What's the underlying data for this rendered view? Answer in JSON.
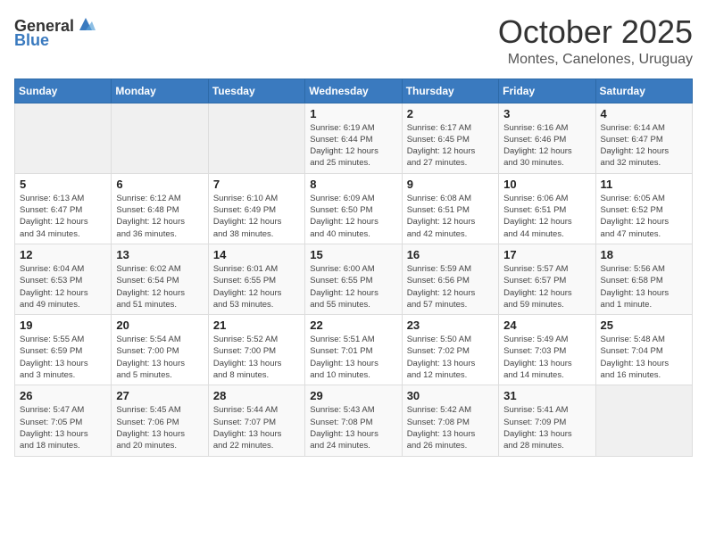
{
  "logo": {
    "general": "General",
    "blue": "Blue"
  },
  "title": {
    "month": "October 2025",
    "location": "Montes, Canelones, Uruguay"
  },
  "weekdays": [
    "Sunday",
    "Monday",
    "Tuesday",
    "Wednesday",
    "Thursday",
    "Friday",
    "Saturday"
  ],
  "weeks": [
    [
      {
        "day": "",
        "info": ""
      },
      {
        "day": "",
        "info": ""
      },
      {
        "day": "",
        "info": ""
      },
      {
        "day": "1",
        "info": "Sunrise: 6:19 AM\nSunset: 6:44 PM\nDaylight: 12 hours\nand 25 minutes."
      },
      {
        "day": "2",
        "info": "Sunrise: 6:17 AM\nSunset: 6:45 PM\nDaylight: 12 hours\nand 27 minutes."
      },
      {
        "day": "3",
        "info": "Sunrise: 6:16 AM\nSunset: 6:46 PM\nDaylight: 12 hours\nand 30 minutes."
      },
      {
        "day": "4",
        "info": "Sunrise: 6:14 AM\nSunset: 6:47 PM\nDaylight: 12 hours\nand 32 minutes."
      }
    ],
    [
      {
        "day": "5",
        "info": "Sunrise: 6:13 AM\nSunset: 6:47 PM\nDaylight: 12 hours\nand 34 minutes."
      },
      {
        "day": "6",
        "info": "Sunrise: 6:12 AM\nSunset: 6:48 PM\nDaylight: 12 hours\nand 36 minutes."
      },
      {
        "day": "7",
        "info": "Sunrise: 6:10 AM\nSunset: 6:49 PM\nDaylight: 12 hours\nand 38 minutes."
      },
      {
        "day": "8",
        "info": "Sunrise: 6:09 AM\nSunset: 6:50 PM\nDaylight: 12 hours\nand 40 minutes."
      },
      {
        "day": "9",
        "info": "Sunrise: 6:08 AM\nSunset: 6:51 PM\nDaylight: 12 hours\nand 42 minutes."
      },
      {
        "day": "10",
        "info": "Sunrise: 6:06 AM\nSunset: 6:51 PM\nDaylight: 12 hours\nand 44 minutes."
      },
      {
        "day": "11",
        "info": "Sunrise: 6:05 AM\nSunset: 6:52 PM\nDaylight: 12 hours\nand 47 minutes."
      }
    ],
    [
      {
        "day": "12",
        "info": "Sunrise: 6:04 AM\nSunset: 6:53 PM\nDaylight: 12 hours\nand 49 minutes."
      },
      {
        "day": "13",
        "info": "Sunrise: 6:02 AM\nSunset: 6:54 PM\nDaylight: 12 hours\nand 51 minutes."
      },
      {
        "day": "14",
        "info": "Sunrise: 6:01 AM\nSunset: 6:55 PM\nDaylight: 12 hours\nand 53 minutes."
      },
      {
        "day": "15",
        "info": "Sunrise: 6:00 AM\nSunset: 6:55 PM\nDaylight: 12 hours\nand 55 minutes."
      },
      {
        "day": "16",
        "info": "Sunrise: 5:59 AM\nSunset: 6:56 PM\nDaylight: 12 hours\nand 57 minutes."
      },
      {
        "day": "17",
        "info": "Sunrise: 5:57 AM\nSunset: 6:57 PM\nDaylight: 12 hours\nand 59 minutes."
      },
      {
        "day": "18",
        "info": "Sunrise: 5:56 AM\nSunset: 6:58 PM\nDaylight: 13 hours\nand 1 minute."
      }
    ],
    [
      {
        "day": "19",
        "info": "Sunrise: 5:55 AM\nSunset: 6:59 PM\nDaylight: 13 hours\nand 3 minutes."
      },
      {
        "day": "20",
        "info": "Sunrise: 5:54 AM\nSunset: 7:00 PM\nDaylight: 13 hours\nand 5 minutes."
      },
      {
        "day": "21",
        "info": "Sunrise: 5:52 AM\nSunset: 7:00 PM\nDaylight: 13 hours\nand 8 minutes."
      },
      {
        "day": "22",
        "info": "Sunrise: 5:51 AM\nSunset: 7:01 PM\nDaylight: 13 hours\nand 10 minutes."
      },
      {
        "day": "23",
        "info": "Sunrise: 5:50 AM\nSunset: 7:02 PM\nDaylight: 13 hours\nand 12 minutes."
      },
      {
        "day": "24",
        "info": "Sunrise: 5:49 AM\nSunset: 7:03 PM\nDaylight: 13 hours\nand 14 minutes."
      },
      {
        "day": "25",
        "info": "Sunrise: 5:48 AM\nSunset: 7:04 PM\nDaylight: 13 hours\nand 16 minutes."
      }
    ],
    [
      {
        "day": "26",
        "info": "Sunrise: 5:47 AM\nSunset: 7:05 PM\nDaylight: 13 hours\nand 18 minutes."
      },
      {
        "day": "27",
        "info": "Sunrise: 5:45 AM\nSunset: 7:06 PM\nDaylight: 13 hours\nand 20 minutes."
      },
      {
        "day": "28",
        "info": "Sunrise: 5:44 AM\nSunset: 7:07 PM\nDaylight: 13 hours\nand 22 minutes."
      },
      {
        "day": "29",
        "info": "Sunrise: 5:43 AM\nSunset: 7:08 PM\nDaylight: 13 hours\nand 24 minutes."
      },
      {
        "day": "30",
        "info": "Sunrise: 5:42 AM\nSunset: 7:08 PM\nDaylight: 13 hours\nand 26 minutes."
      },
      {
        "day": "31",
        "info": "Sunrise: 5:41 AM\nSunset: 7:09 PM\nDaylight: 13 hours\nand 28 minutes."
      },
      {
        "day": "",
        "info": ""
      }
    ]
  ]
}
